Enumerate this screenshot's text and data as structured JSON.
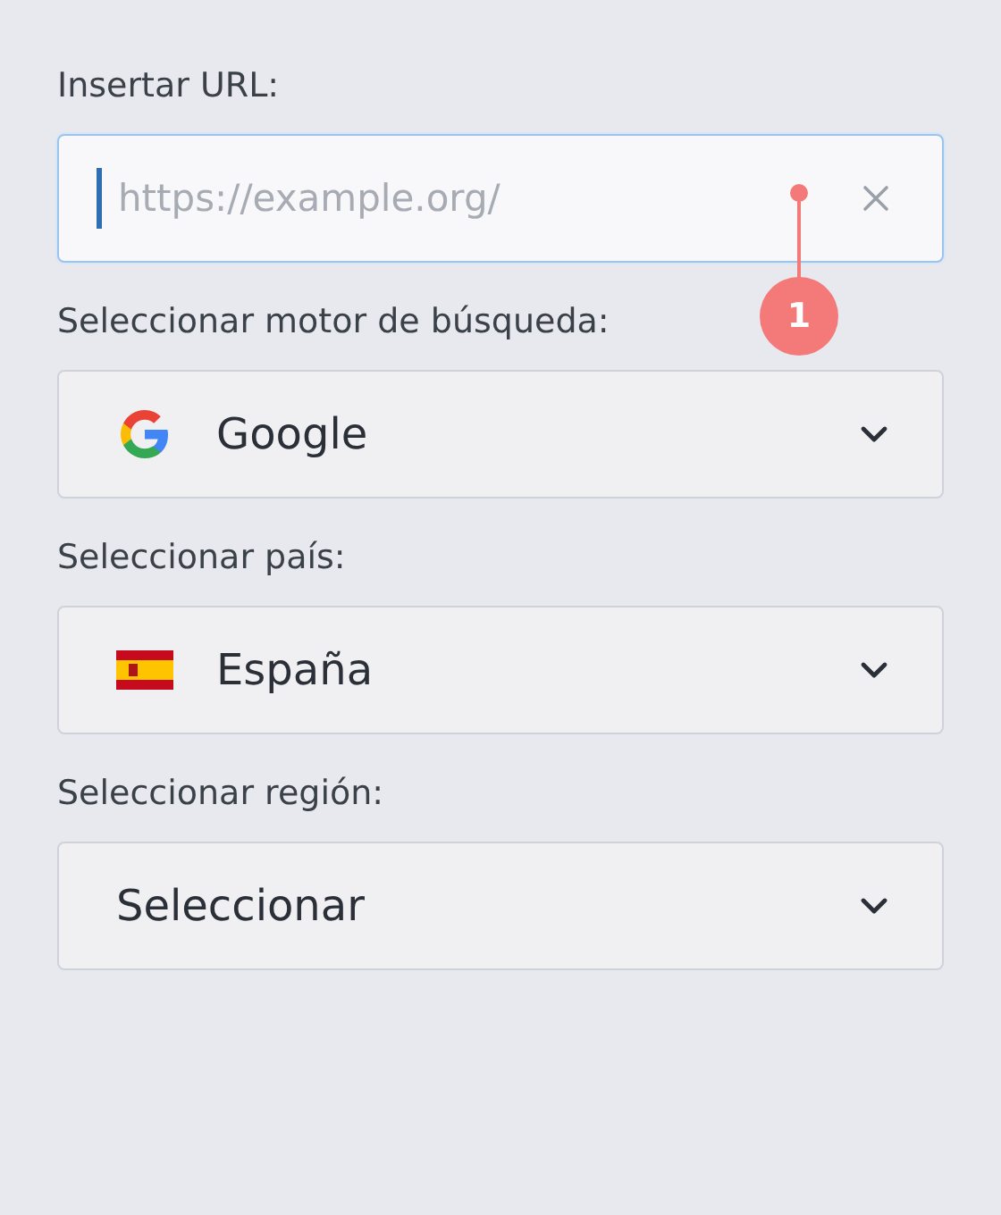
{
  "url_field": {
    "label": "Insertar URL:",
    "placeholder": "https://example.org/",
    "focused": true
  },
  "annotation": {
    "number": "1"
  },
  "selects": [
    {
      "label": "Seleccionar motor de búsqueda:",
      "value": "Google",
      "kind": "google"
    },
    {
      "label": "Seleccionar país:",
      "value": "España",
      "kind": "flag"
    },
    {
      "label": "Seleccionar región:",
      "value": "Seleccionar",
      "kind": "plain"
    }
  ]
}
